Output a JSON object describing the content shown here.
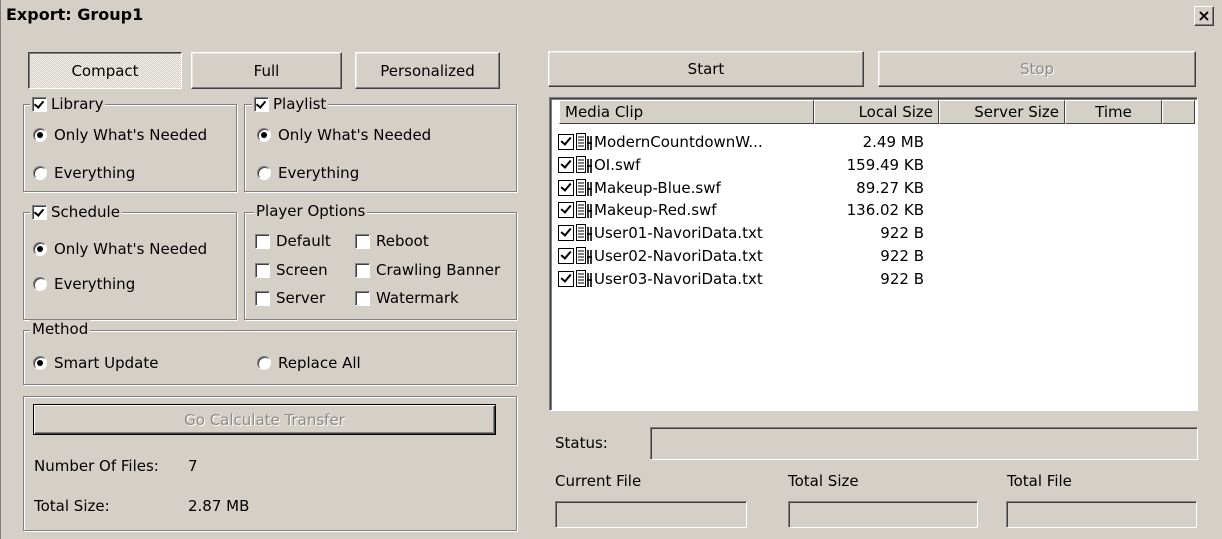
{
  "window": {
    "title": "Export: Group1",
    "close_label": "×"
  },
  "mode_buttons": {
    "compact": "Compact",
    "full": "Full",
    "personalized": "Personalized"
  },
  "library": {
    "label": "Library",
    "only_needed": "Only What's Needed",
    "everything": "Everything"
  },
  "playlist": {
    "label": "Playlist",
    "only_needed": "Only What's Needed",
    "everything": "Everything"
  },
  "schedule": {
    "label": "Schedule",
    "only_needed": "Only What's Needed",
    "everything": "Everything"
  },
  "player_options": {
    "label": "Player Options",
    "default": "Default",
    "reboot": "Reboot",
    "screen": "Screen",
    "crawling_banner": "Crawling Banner",
    "server": "Server",
    "watermark": "Watermark"
  },
  "method": {
    "label": "Method",
    "smart_update": "Smart Update",
    "replace_all": "Replace All"
  },
  "calc": {
    "button": "Go Calculate Transfer",
    "num_files_label": "Number Of Files:",
    "num_files_value": "7",
    "total_size_label": "Total Size:",
    "total_size_value": "2.87 MB"
  },
  "actions": {
    "start": "Start",
    "stop": "Stop"
  },
  "table": {
    "columns": [
      "Media Clip",
      "Local Size",
      "Server Size",
      "Time"
    ],
    "rows": [
      {
        "name": "ModernCountdownW...",
        "size": "2.49 MB"
      },
      {
        "name": "OI.swf",
        "size": "159.49 KB"
      },
      {
        "name": "Makeup-Blue.swf",
        "size": "89.27 KB"
      },
      {
        "name": "Makeup-Red.swf",
        "size": "136.02 KB"
      },
      {
        "name": "User01-NavoriData.txt",
        "size": "922 B"
      },
      {
        "name": "User02-NavoriData.txt",
        "size": "922 B"
      },
      {
        "name": "User03-NavoriData.txt",
        "size": "922 B"
      }
    ]
  },
  "status": {
    "label": "Status:",
    "current_file": "Current File",
    "total_size": "Total Size",
    "total_file": "Total File"
  }
}
